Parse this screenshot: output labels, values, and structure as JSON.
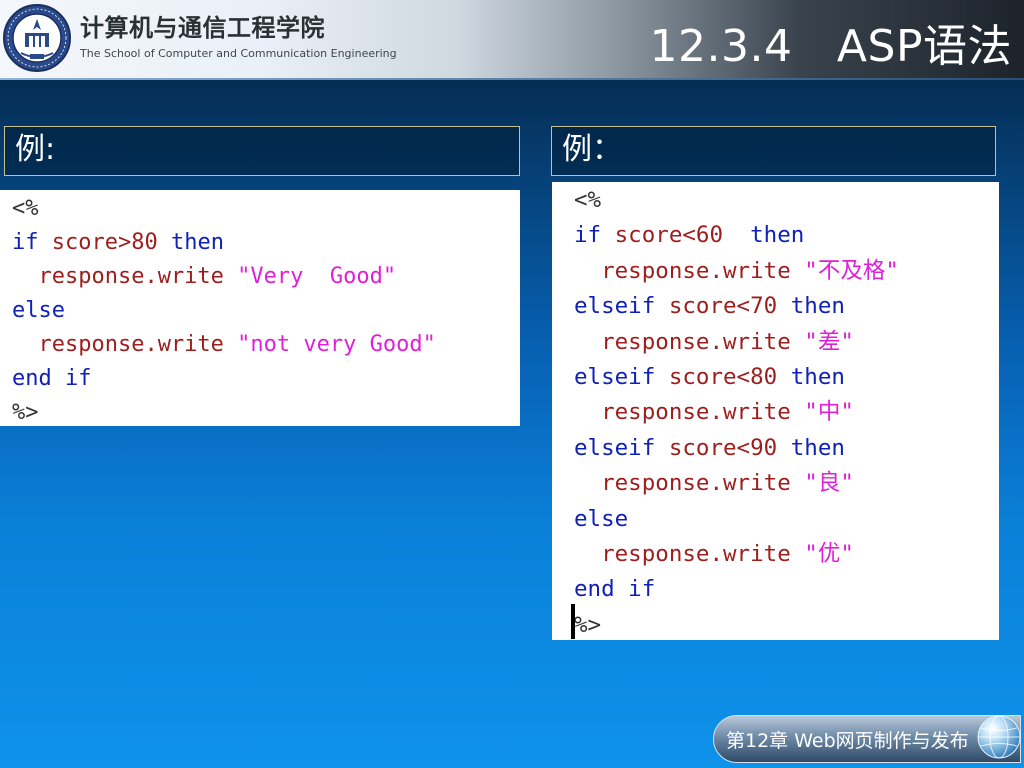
{
  "header": {
    "school_cn": "计算机与通信工程学院",
    "school_en": "The School of Computer and Communication Engineering",
    "logo_icon": "university-seal-icon",
    "slide_title": "12.3.4　ASP语法"
  },
  "left_example": {
    "label": "例:",
    "code": [
      [
        {
          "t": "<%",
          "c": "tag"
        }
      ],
      [
        {
          "t": "if",
          "c": "kw"
        },
        {
          "t": " score>80 ",
          "c": "ident"
        },
        {
          "t": "then",
          "c": "kw"
        }
      ],
      [
        {
          "t": "  response.write ",
          "c": "ident"
        },
        {
          "t": "\"Very  Good\"",
          "c": "str"
        }
      ],
      [
        {
          "t": "else",
          "c": "kw"
        }
      ],
      [
        {
          "t": "  response.write ",
          "c": "ident"
        },
        {
          "t": "\"not very Good\"",
          "c": "str"
        }
      ],
      [
        {
          "t": "end if",
          "c": "kw"
        }
      ],
      [
        {
          "t": "%>",
          "c": "tag"
        }
      ]
    ]
  },
  "right_example": {
    "label": "例：",
    "code": [
      [
        {
          "t": "<%",
          "c": "tag"
        }
      ],
      [
        {
          "t": "if",
          "c": "kw"
        },
        {
          "t": " score<60  ",
          "c": "ident"
        },
        {
          "t": "then",
          "c": "kw"
        }
      ],
      [
        {
          "t": "  response.write ",
          "c": "ident"
        },
        {
          "t": "\"不及格\"",
          "c": "str"
        }
      ],
      [
        {
          "t": "elseif",
          "c": "kw"
        },
        {
          "t": " score<70 ",
          "c": "ident"
        },
        {
          "t": "then",
          "c": "kw"
        }
      ],
      [
        {
          "t": "  response.write ",
          "c": "ident"
        },
        {
          "t": "\"差\"",
          "c": "str"
        }
      ],
      [
        {
          "t": "elseif",
          "c": "kw"
        },
        {
          "t": " score<80 ",
          "c": "ident"
        },
        {
          "t": "then",
          "c": "kw"
        }
      ],
      [
        {
          "t": "  response.write ",
          "c": "ident"
        },
        {
          "t": "\"中\"",
          "c": "str"
        }
      ],
      [
        {
          "t": "elseif",
          "c": "kw"
        },
        {
          "t": " score<90 ",
          "c": "ident"
        },
        {
          "t": "then",
          "c": "kw"
        }
      ],
      [
        {
          "t": "  response.write ",
          "c": "ident"
        },
        {
          "t": "\"良\"",
          "c": "str"
        }
      ],
      [
        {
          "t": "else",
          "c": "kw"
        }
      ],
      [
        {
          "t": "  response.write ",
          "c": "ident"
        },
        {
          "t": "\"优\"",
          "c": "str"
        }
      ],
      [
        {
          "t": "end if",
          "c": "kw"
        }
      ],
      [
        {
          "t": "%>",
          "c": "tag"
        }
      ]
    ]
  },
  "footer": {
    "chapter": "第12章 Web网页制作与发布",
    "globe_icon": "globe-icon"
  },
  "colors": {
    "keyword": "#1020b8",
    "identifier": "#9e1e1e",
    "string": "#e020d8",
    "label_border": "#c6c18b"
  }
}
